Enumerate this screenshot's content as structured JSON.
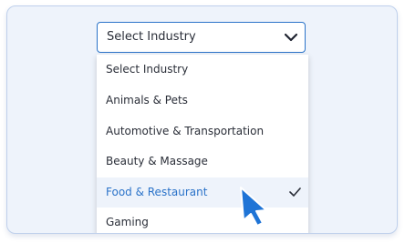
{
  "select": {
    "value": "Select Industry"
  },
  "dropdown": {
    "options": [
      {
        "label": "Select Industry"
      },
      {
        "label": "Animals & Pets"
      },
      {
        "label": "Automotive & Transportation"
      },
      {
        "label": "Beauty & Massage"
      },
      {
        "label": "Food & Restaurant"
      },
      {
        "label": "Gaming"
      }
    ],
    "selected_index": 4
  },
  "colors": {
    "accent": "#2b73c9",
    "card_background": "#eef3fb",
    "text": "#2a2e38",
    "cursor": "#1f74d6"
  },
  "icons": {
    "chevron": "chevron-down-icon",
    "check": "checkmark-icon",
    "cursor": "mouse-pointer-icon"
  }
}
